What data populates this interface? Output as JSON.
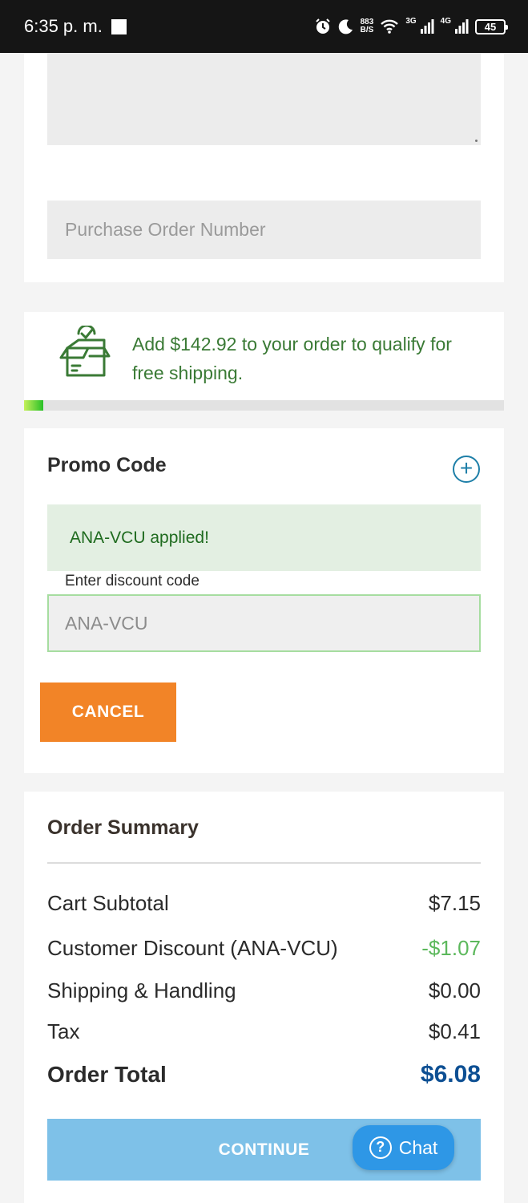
{
  "status_bar": {
    "time": "6:35 p. m.",
    "net_speed_top": "883",
    "net_speed_unit": "B/S",
    "network_3g": "3G",
    "network_4g": "4G",
    "battery": "45"
  },
  "form": {
    "po_placeholder": "Purchase Order Number"
  },
  "shipping": {
    "message": "Add $142.92 to your order to qualify for free shipping.",
    "progress_fraction": 0.04,
    "icon": "box-check-icon"
  },
  "promo": {
    "title": "Promo Code",
    "applied_message": "ANA-VCU applied!",
    "input_label": "Enter discount code",
    "input_value": "ANA-VCU",
    "cancel_label": "CANCEL",
    "expand_icon": "plus-circle-icon"
  },
  "summary": {
    "title": "Order Summary",
    "rows": [
      {
        "label": "Cart Subtotal",
        "value": "$7.15"
      },
      {
        "label": "Customer Discount (ANA-VCU)",
        "value": "-$1.07"
      },
      {
        "label": "Shipping & Handling",
        "value": "$0.00"
      },
      {
        "label": "Tax",
        "value": "$0.41"
      }
    ],
    "total_label": "Order Total",
    "total_value": "$6.08",
    "continue_label": "CONTINUE"
  },
  "chat": {
    "label": "Chat",
    "icon": "question-circle-icon"
  },
  "colors": {
    "accent_orange": "#f28427",
    "continue_blue": "#7ec1e8",
    "total_blue": "#0d4f93",
    "success_green": "#3a7a35",
    "discount_green": "#5cb85c",
    "chat_blue": "#2e97e6"
  }
}
